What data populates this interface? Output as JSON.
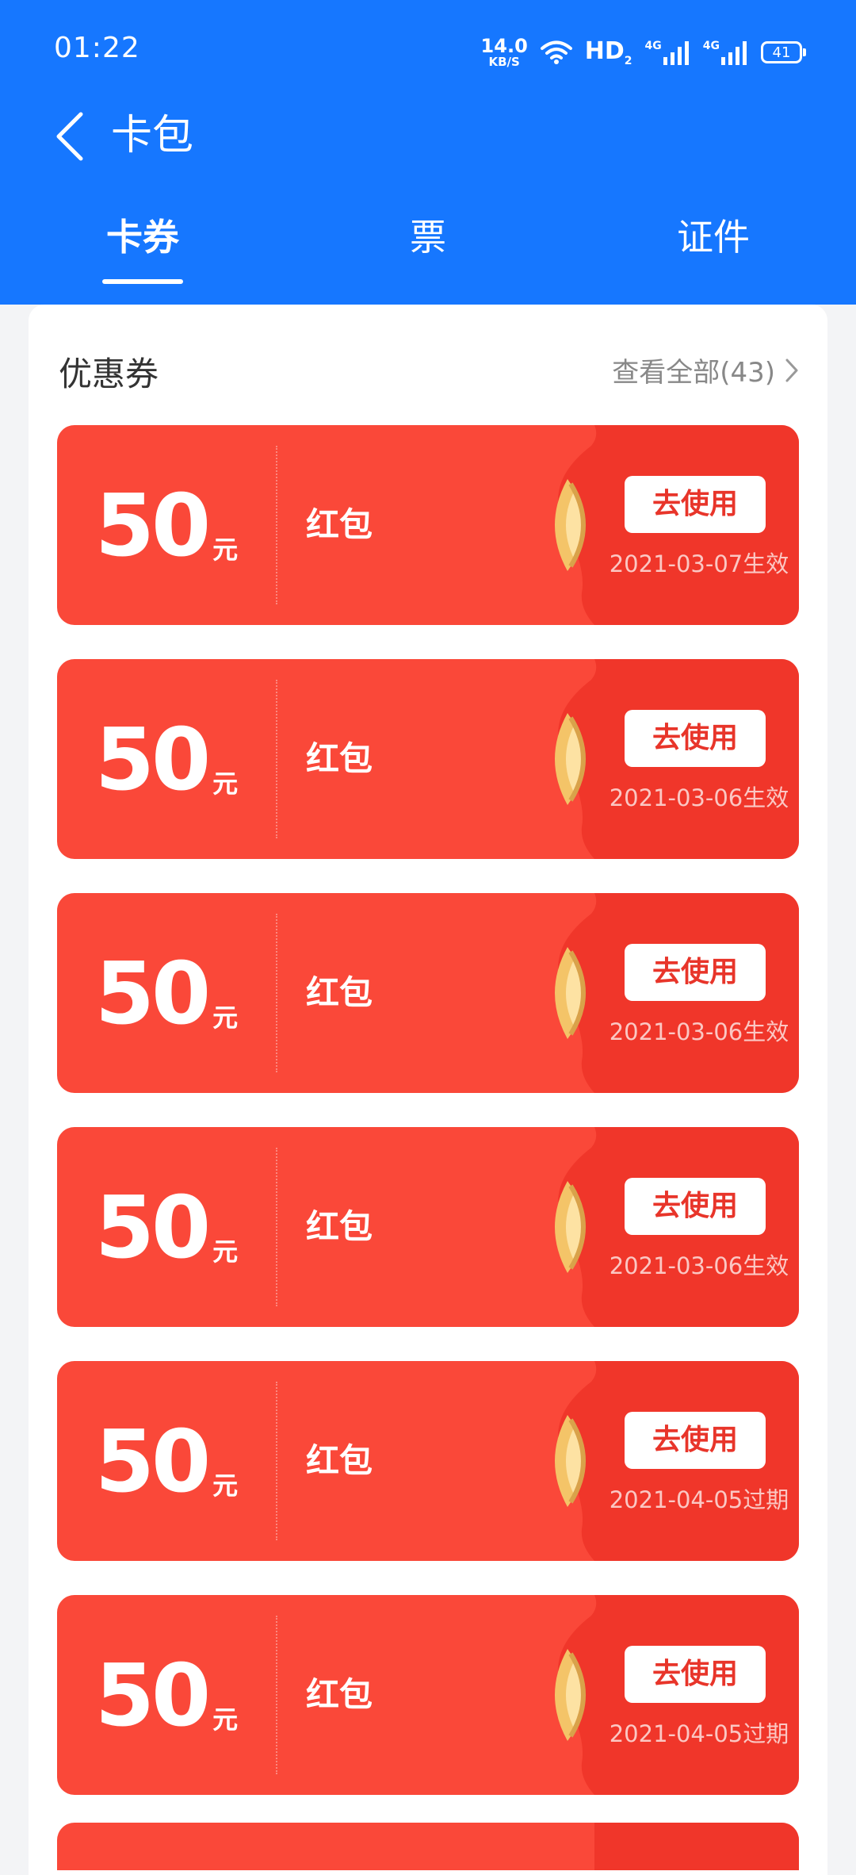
{
  "status_bar": {
    "time": "01:22",
    "net_speed": "14.0",
    "net_speed_unit": "KB/S",
    "hd": "HD",
    "signal1": "4G",
    "signal2": "4G",
    "battery": "41"
  },
  "nav": {
    "title": "卡包",
    "back_icon": "chevron-left-icon"
  },
  "tabs": [
    {
      "label": "卡券",
      "active": true
    },
    {
      "label": "票",
      "active": false
    },
    {
      "label": "证件",
      "active": false
    }
  ],
  "section": {
    "title": "优惠券",
    "view_all": "查看全部(43)"
  },
  "coupons": [
    {
      "amount": "50",
      "unit": "元",
      "name": "红包",
      "button": "去使用",
      "date": "2021-03-07生效"
    },
    {
      "amount": "50",
      "unit": "元",
      "name": "红包",
      "button": "去使用",
      "date": "2021-03-06生效"
    },
    {
      "amount": "50",
      "unit": "元",
      "name": "红包",
      "button": "去使用",
      "date": "2021-03-06生效"
    },
    {
      "amount": "50",
      "unit": "元",
      "name": "红包",
      "button": "去使用",
      "date": "2021-03-06生效"
    },
    {
      "amount": "50",
      "unit": "元",
      "name": "红包",
      "button": "去使用",
      "date": "2021-04-05过期"
    },
    {
      "amount": "50",
      "unit": "元",
      "name": "红包",
      "button": "去使用",
      "date": "2021-04-05过期"
    }
  ],
  "colors": {
    "header_blue": "#1677ff",
    "coupon_red": "#fa4839",
    "coupon_red_dark": "#f0362a",
    "button_text": "#e8352a",
    "gold": "#f4c468"
  }
}
